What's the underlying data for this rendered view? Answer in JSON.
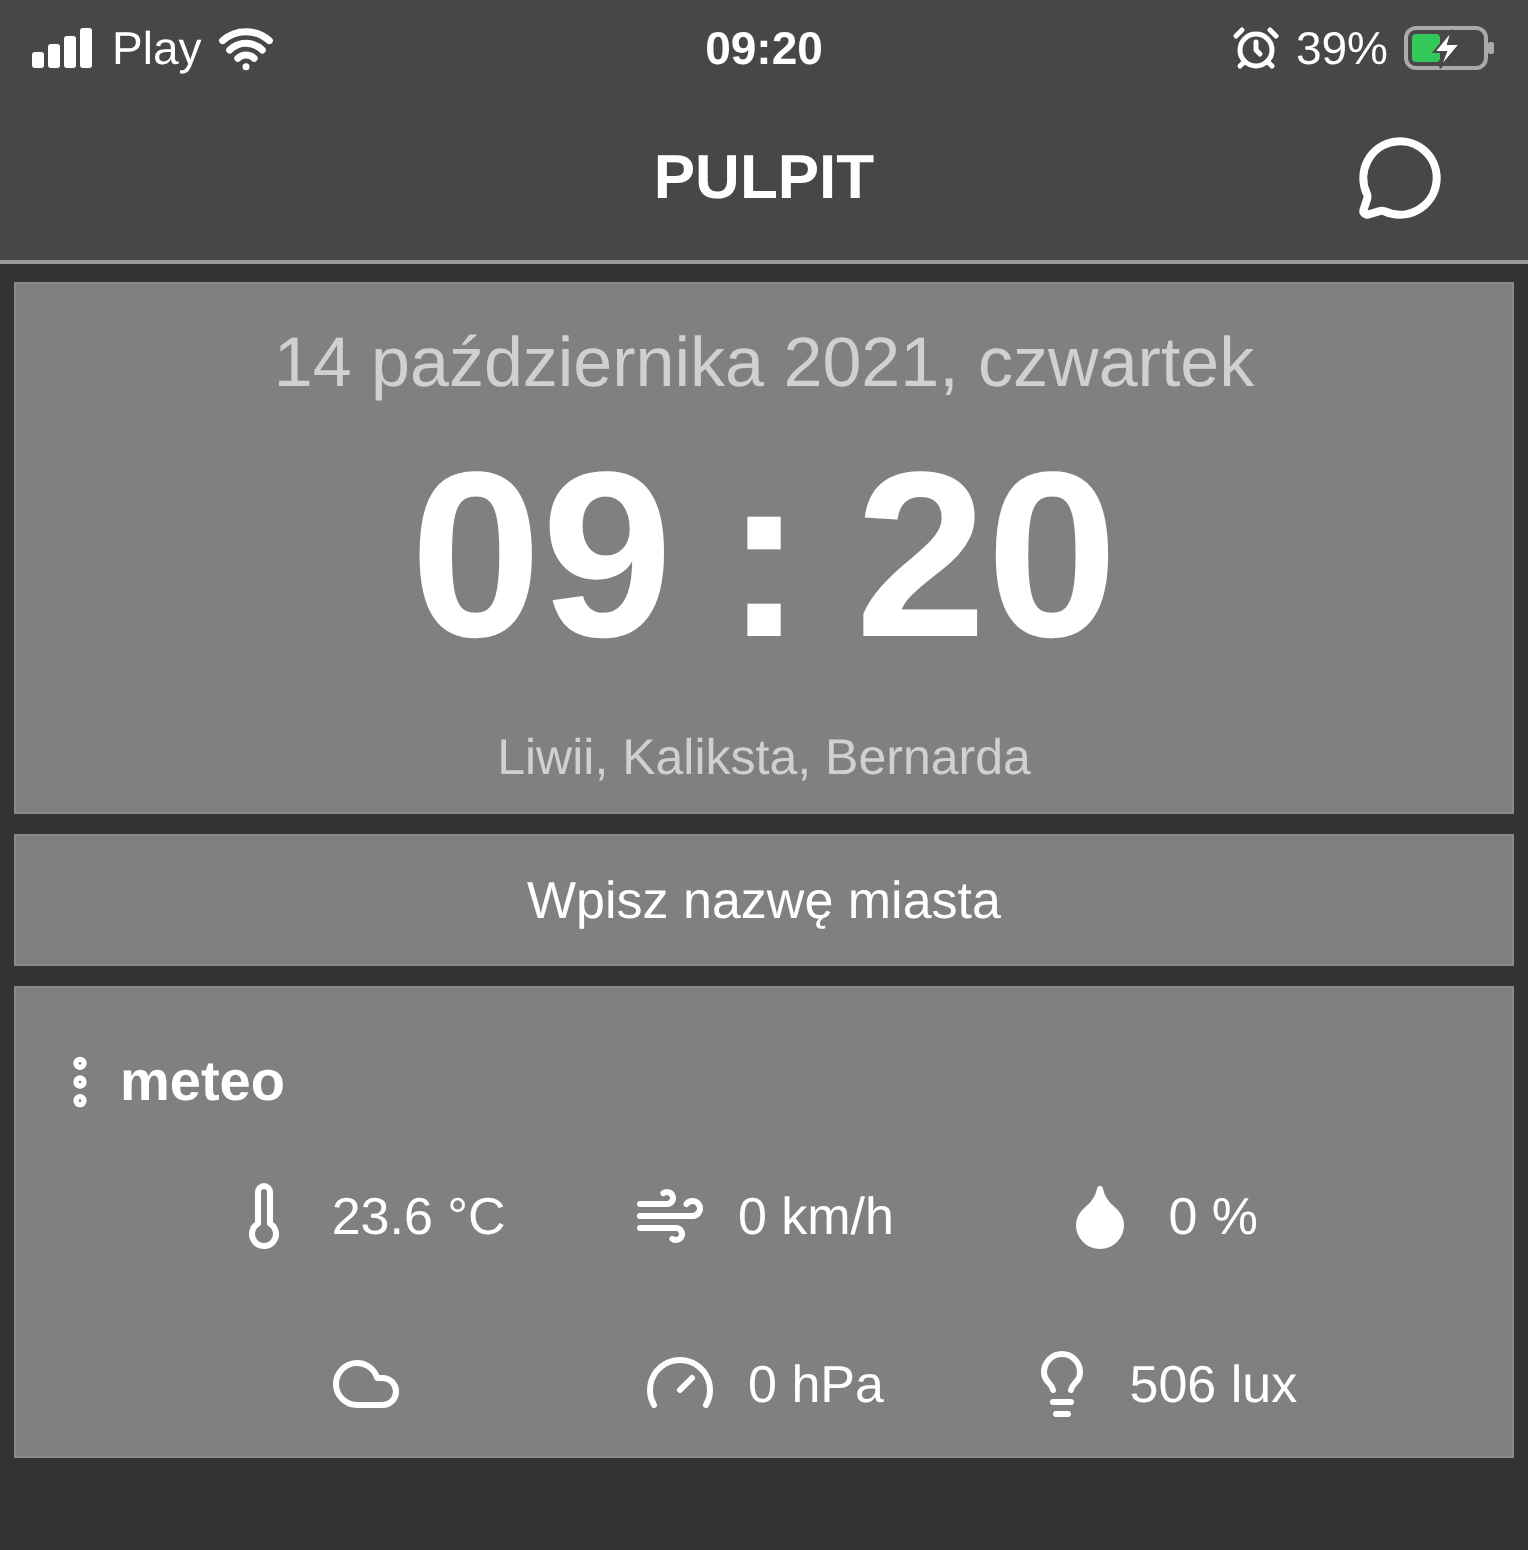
{
  "status_bar": {
    "carrier": "Play",
    "time": "09:20",
    "battery": "39%"
  },
  "header": {
    "title": "PULPIT"
  },
  "clock": {
    "date": "14 października 2021, czwartek",
    "hours": "09",
    "separator": ":",
    "minutes": "20",
    "name_days": "Liwii, Kaliksta, Bernarda"
  },
  "city_field": {
    "placeholder": "Wpisz nazwę miasta"
  },
  "meteo": {
    "title": "meteo",
    "items": [
      {
        "kind": "temperature",
        "value": "23.6 °C"
      },
      {
        "kind": "wind",
        "value": "0 km/h"
      },
      {
        "kind": "humidity",
        "value": "0 %"
      },
      {
        "kind": "cloud"
      },
      {
        "kind": "pressure",
        "value": "0 hPa"
      },
      {
        "kind": "light",
        "value": "506 lux"
      }
    ]
  }
}
